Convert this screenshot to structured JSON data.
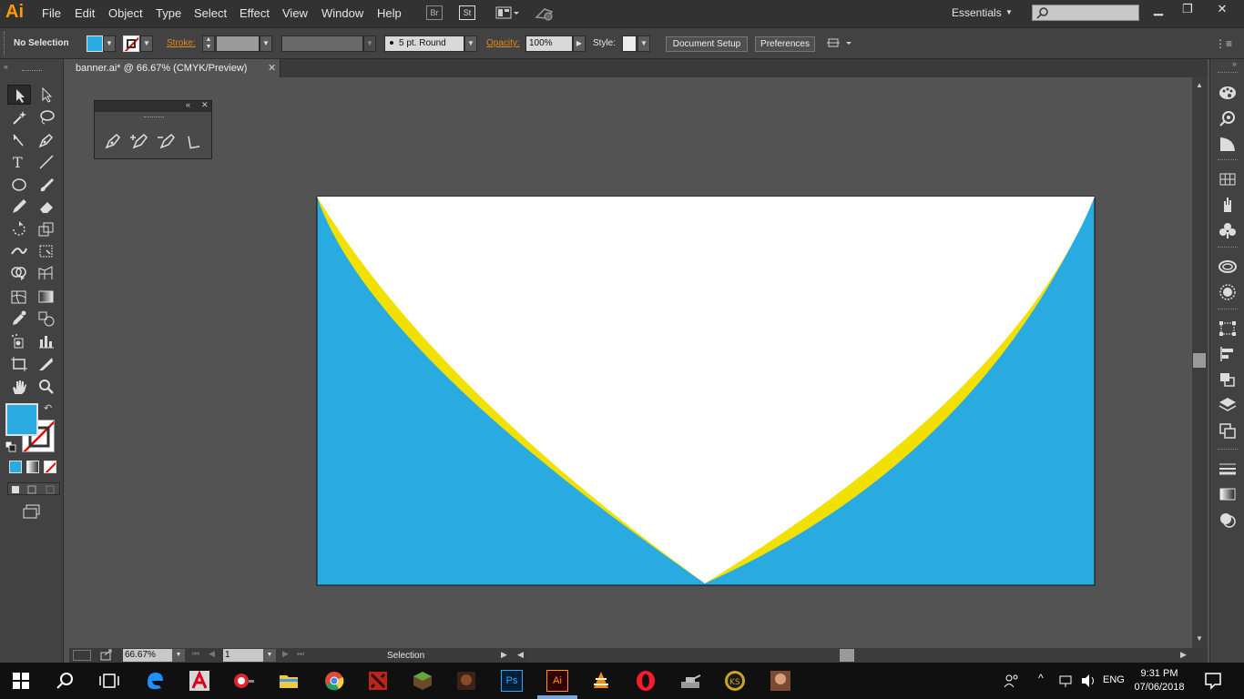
{
  "app": {
    "logo": "Ai"
  },
  "menubar": {
    "items": [
      "File",
      "Edit",
      "Object",
      "Type",
      "Select",
      "Effect",
      "View",
      "Window",
      "Help"
    ],
    "bridge_icon": "Br",
    "stock_icon": "St",
    "workspace": "Essentials",
    "search_placeholder": ""
  },
  "controlbar": {
    "selection_status": "No Selection",
    "stroke_label": "Stroke:",
    "brush_value": "5 pt. Round",
    "opacity_label": "Opacity:",
    "opacity_value": "100%",
    "style_label": "Style:",
    "document_setup_label": "Document Setup",
    "preferences_label": "Preferences",
    "fill_color": "#29abe2"
  },
  "document": {
    "tab_title": "banner.ai* @ 66.67% (CMYK/Preview)",
    "artwork_colors": {
      "background": "#29abe2",
      "accent": "#f2e100",
      "center": "#ffffff"
    }
  },
  "statusbar": {
    "zoom_value": "66.67%",
    "artboard_value": "1",
    "tool_status": "Selection"
  },
  "taskbar": {
    "language": "ENG",
    "time": "9:31 PM",
    "date": "07/06/2018",
    "ai_icon_label": "Ai",
    "ps_icon_label": "Ps"
  }
}
